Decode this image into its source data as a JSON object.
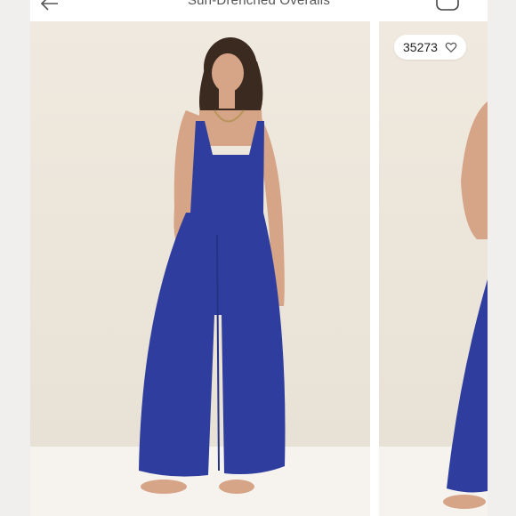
{
  "header": {
    "title": "Sun-Drenched Overalls",
    "back_icon": "arrow-left-icon",
    "bag_icon": "shopping-bag-icon"
  },
  "gallery": {
    "likes_count": "35273",
    "heart_icon": "heart-outline-icon",
    "colors": {
      "overalls": "#2f3e9e",
      "background": "#ebe4d9",
      "skin": "#d7a58a"
    }
  }
}
